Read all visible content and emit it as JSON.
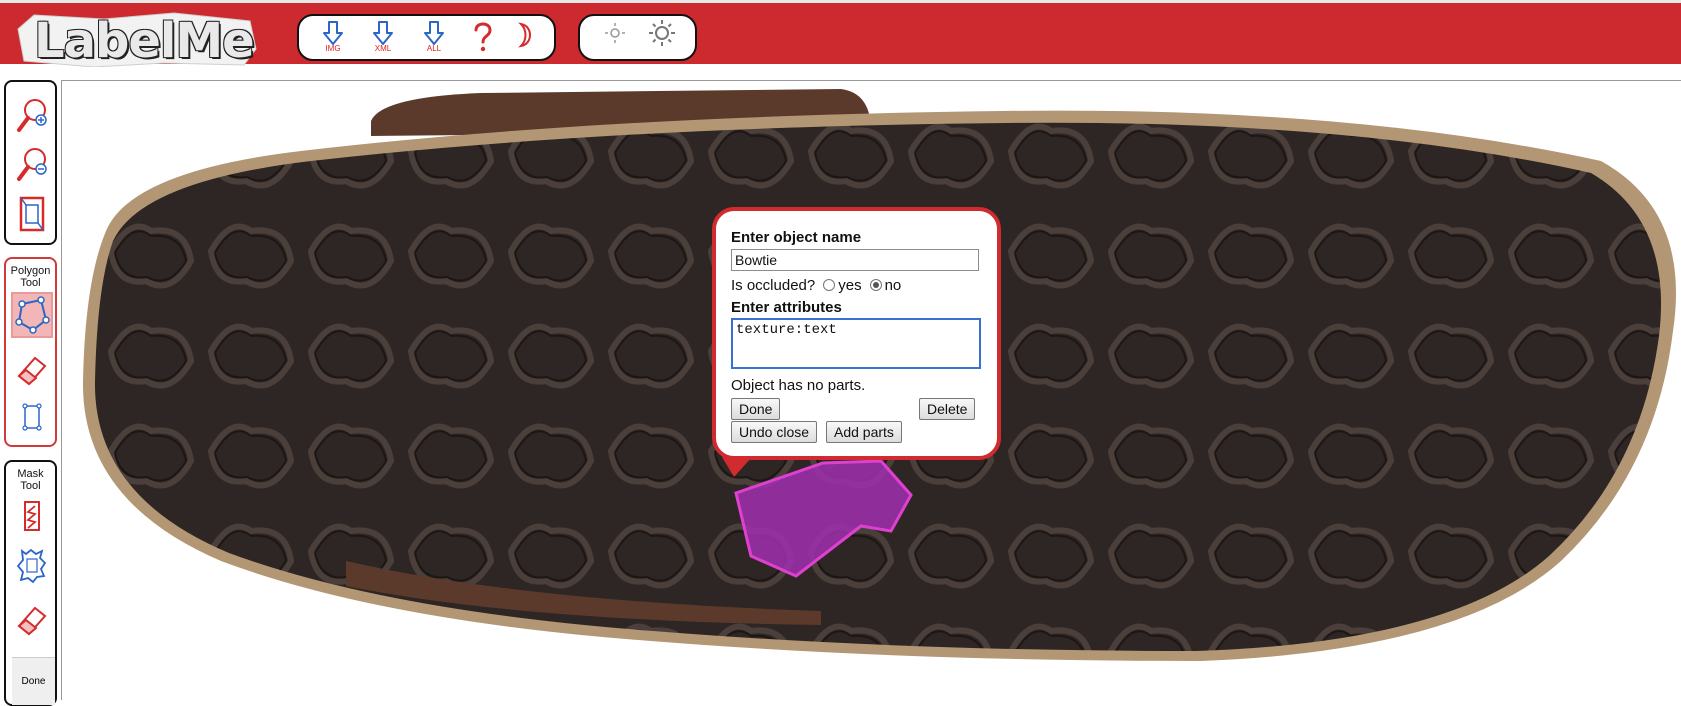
{
  "app": {
    "logo_text": "LabelMe"
  },
  "toolbar": {
    "img_label": "IMG",
    "xml_label": "XML",
    "all_label": "ALL"
  },
  "sidebar": {
    "polygon_tool_title": "Polygon Tool",
    "mask_tool_title": "Mask Tool",
    "done_label": "Done"
  },
  "popup": {
    "name_heading": "Enter object name",
    "name_value": "Bowtie",
    "occluded_question": "Is occluded?",
    "yes_label": "yes",
    "no_label": "no",
    "occluded_selected": "no",
    "attributes_heading": "Enter attributes",
    "attributes_value": "texture:text",
    "parts_text": "Object has no parts.",
    "done_button": "Done",
    "delete_button": "Delete",
    "undo_close_button": "Undo close",
    "add_parts_button": "Add parts"
  },
  "colors": {
    "header_red": "#cd2a30",
    "polygon_fill": "#a030b0",
    "polygon_stroke": "#e040d0",
    "sole_dark": "#2e2624"
  }
}
